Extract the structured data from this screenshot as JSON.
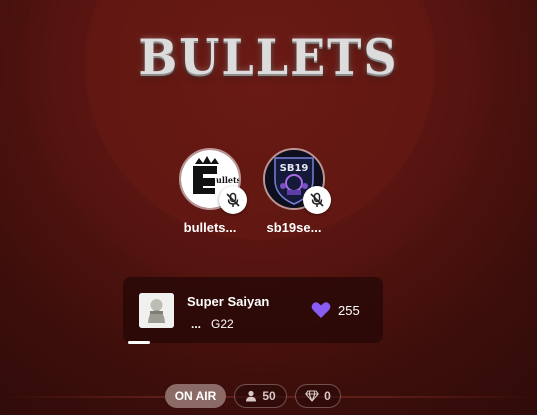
{
  "room": {
    "title": "BULLETS"
  },
  "speakers": [
    {
      "name": "bullets...",
      "muted": true,
      "avatar_text": "Bullets"
    },
    {
      "name": "sb19se...",
      "muted": true,
      "avatar_text": "SB19"
    }
  ],
  "now_playing": {
    "title": "Super Saiyan",
    "artist_prefix": "...",
    "artist": "G22",
    "likes": "255",
    "progress_fraction": 0.08
  },
  "status_bar": {
    "on_air_label": "ON AIR",
    "listeners": "50",
    "gems": "0"
  },
  "colors": {
    "background": "#3a0d0b",
    "like_heart": "#8a5cf6",
    "on_air_pill": "#8c6b67"
  },
  "icons": [
    "mic-off-icon",
    "heart-icon",
    "person-icon",
    "diamond-icon"
  ]
}
